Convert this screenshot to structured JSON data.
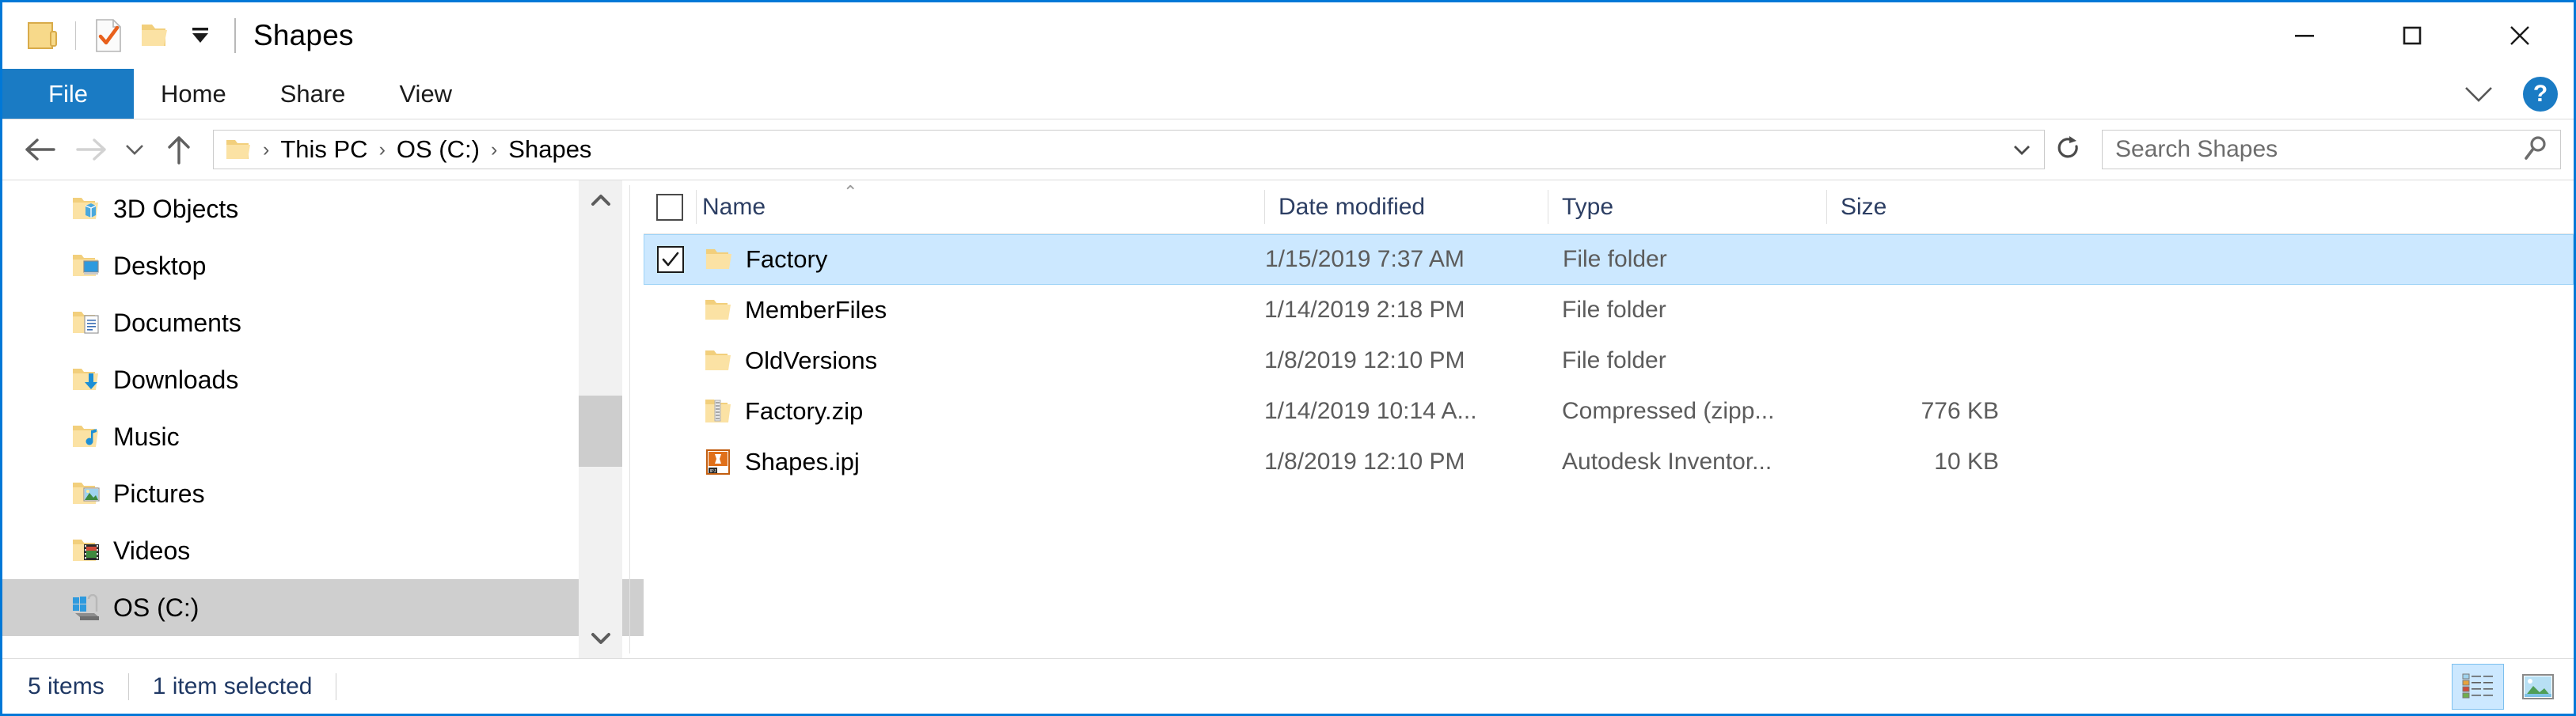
{
  "window": {
    "title": "Shapes",
    "quick_access": [
      {
        "name": "folder-icon",
        "label": "Folder"
      },
      {
        "name": "properties-icon",
        "label": "Properties"
      },
      {
        "name": "new-folder-icon",
        "label": "New folder"
      },
      {
        "name": "chevron-down-icon",
        "label": "Customize Quick Access Toolbar"
      }
    ],
    "controls": {
      "minimize": "—",
      "maximize": "□",
      "close": "✕"
    }
  },
  "ribbon": {
    "tabs": [
      {
        "label": "File",
        "active": true
      },
      {
        "label": "Home",
        "active": false
      },
      {
        "label": "Share",
        "active": false
      },
      {
        "label": "View",
        "active": false
      }
    ],
    "collapse_label": "Minimize the Ribbon",
    "help_label": "?"
  },
  "address": {
    "back_label": "Back",
    "forward_label": "Forward",
    "recent_label": "Recent locations",
    "up_label": "Up",
    "breadcrumbs": [
      "This PC",
      "OS (C:)",
      "Shapes"
    ],
    "separator": "›",
    "dropdown_label": "Previous Locations",
    "refresh_label": "Refresh"
  },
  "search": {
    "placeholder": "Search Shapes",
    "value": "",
    "icon": "search-icon"
  },
  "navpane": {
    "items": [
      {
        "label": "3D Objects",
        "icon": "folder-3d-objects-icon",
        "selected": false
      },
      {
        "label": "Desktop",
        "icon": "folder-desktop-icon",
        "selected": false
      },
      {
        "label": "Documents",
        "icon": "folder-documents-icon",
        "selected": false
      },
      {
        "label": "Downloads",
        "icon": "folder-downloads-icon",
        "selected": false
      },
      {
        "label": "Music",
        "icon": "folder-music-icon",
        "selected": false
      },
      {
        "label": "Pictures",
        "icon": "folder-pictures-icon",
        "selected": false
      },
      {
        "label": "Videos",
        "icon": "folder-videos-icon",
        "selected": false
      },
      {
        "label": "OS (C:)",
        "icon": "drive-icon",
        "selected": true
      }
    ]
  },
  "filelist": {
    "columns": {
      "name": "Name",
      "date_modified": "Date modified",
      "type": "Type",
      "size": "Size"
    },
    "sort_indicator": "⌃",
    "rows": [
      {
        "name": "Factory",
        "date_modified": "1/15/2019 7:37 AM",
        "type": "File folder",
        "size": "",
        "icon": "folder-icon",
        "selected": true,
        "checked": true
      },
      {
        "name": "MemberFiles",
        "date_modified": "1/14/2019 2:18 PM",
        "type": "File folder",
        "size": "",
        "icon": "folder-icon",
        "selected": false,
        "checked": false
      },
      {
        "name": "OldVersions",
        "date_modified": "1/8/2019 12:10 PM",
        "type": "File folder",
        "size": "",
        "icon": "folder-icon",
        "selected": false,
        "checked": false
      },
      {
        "name": "Factory.zip",
        "date_modified": "1/14/2019 10:14 A...",
        "type": "Compressed (zipp...",
        "size": "776 KB",
        "icon": "zip-icon",
        "selected": false,
        "checked": false
      },
      {
        "name": "Shapes.ipj",
        "date_modified": "1/8/2019 12:10 PM",
        "type": "Autodesk Inventor...",
        "size": "10 KB",
        "icon": "inventor-project-icon",
        "selected": false,
        "checked": false
      }
    ]
  },
  "statusbar": {
    "item_count": "5 items",
    "selection": "1 item selected",
    "views": [
      {
        "name": "details-view-button",
        "active": true
      },
      {
        "name": "large-icons-view-button",
        "active": false
      }
    ]
  },
  "colors": {
    "accent": "#1a7bc4",
    "selection": "#cce8ff",
    "nav_selection": "#cfcfcf",
    "header_text": "#2c3e63",
    "folder": "#f6d785"
  }
}
